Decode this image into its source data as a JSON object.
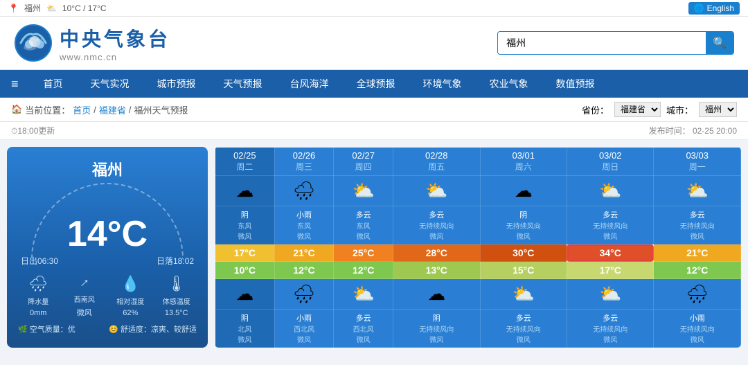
{
  "topbar": {
    "location": "福州",
    "weather_icon": "⛅",
    "temp_range": "10°C / 17°C",
    "lang_label": "English"
  },
  "header": {
    "logo_cn": "中央气象台",
    "logo_url": "www.nmc.cn",
    "search_placeholder": "福州",
    "search_value": "福州"
  },
  "nav": {
    "hamburger": "≡",
    "items": [
      "首页",
      "天气实况",
      "城市预报",
      "天气预报",
      "台风海洋",
      "全球预报",
      "环境气象",
      "农业气象",
      "数值预报"
    ]
  },
  "breadcrumb": {
    "home": "首页",
    "province": "福建省",
    "page": "福州天气预报",
    "province_label": "省份：",
    "province_value": "福建省",
    "city_label": "城市：",
    "city_value": "福州"
  },
  "update": {
    "time_label": "⏱18:00更新",
    "publish_label": "发布时间：",
    "publish_time": "02-25 20:00"
  },
  "current": {
    "city": "福州",
    "temp": "14°C",
    "sunrise": "日出06:30",
    "sunset": "日落18:02",
    "stats": [
      {
        "icon": "🌧",
        "label": "降水量",
        "value": "0mm"
      },
      {
        "icon": "↑",
        "label": "西南风",
        "value": "微风"
      },
      {
        "icon": "💧",
        "label": "相对湿度",
        "value": "62%"
      },
      {
        "icon": "🌡",
        "label": "体感温度",
        "value": "13.5°C"
      }
    ],
    "air_quality": "空气质量：优",
    "comfort": "舒适度：凉爽、较舒适"
  },
  "forecast": {
    "days": [
      {
        "date": "02/25",
        "weekday": "周二",
        "icon": "☁",
        "desc": "阴",
        "wind_dir": "东风",
        "wind_speed": "微风",
        "high": "17°C",
        "low": "10°C",
        "night_icon": "☁",
        "night_desc": "阴",
        "night_wind_dir": "北风",
        "night_wind_speed": "微风"
      },
      {
        "date": "02/26",
        "weekday": "周三",
        "icon": "🌧",
        "desc": "小雨",
        "wind_dir": "东风",
        "wind_speed": "微风",
        "high": "21°C",
        "low": "12°C",
        "night_icon": "🌧",
        "night_desc": "小雨",
        "night_wind_dir": "西北风",
        "night_wind_speed": "微风"
      },
      {
        "date": "02/27",
        "weekday": "周四",
        "icon": "⛅",
        "desc": "多云",
        "wind_dir": "东风",
        "wind_speed": "微风",
        "high": "25°C",
        "low": "12°C",
        "night_icon": "⛅",
        "night_desc": "多云",
        "night_wind_dir": "西北风",
        "night_wind_speed": "微风"
      },
      {
        "date": "02/28",
        "weekday": "周五",
        "icon": "⛅",
        "desc": "多云",
        "wind_dir": "无持续风向",
        "wind_speed": "微风",
        "high": "28°C",
        "low": "13°C",
        "night_icon": "☁",
        "night_desc": "阴",
        "night_wind_dir": "无持续风向",
        "night_wind_speed": "微风"
      },
      {
        "date": "03/01",
        "weekday": "周六",
        "icon": "☁",
        "desc": "阴",
        "wind_dir": "无持续风向",
        "wind_speed": "微风",
        "high": "30°C",
        "low": "15°C",
        "night_icon": "⛅",
        "night_desc": "多云",
        "night_wind_dir": "无持续风向",
        "night_wind_speed": "微风"
      },
      {
        "date": "03/02",
        "weekday": "周日",
        "icon": "⛅",
        "desc": "多云",
        "wind_dir": "无持续风向",
        "wind_speed": "微风",
        "high": "34°C",
        "low": "17°C",
        "night_icon": "⛅",
        "night_desc": "多云",
        "night_wind_dir": "无持续风向",
        "night_wind_speed": "微风"
      },
      {
        "date": "03/03",
        "weekday": "周一",
        "icon": "⛅",
        "desc": "多云",
        "wind_dir": "无持续风向",
        "wind_speed": "微风",
        "high": "21°C",
        "low": "12°C",
        "night_icon": "🌧",
        "night_desc": "小雨",
        "night_wind_dir": "无持续风向",
        "night_wind_speed": "微风"
      }
    ]
  }
}
